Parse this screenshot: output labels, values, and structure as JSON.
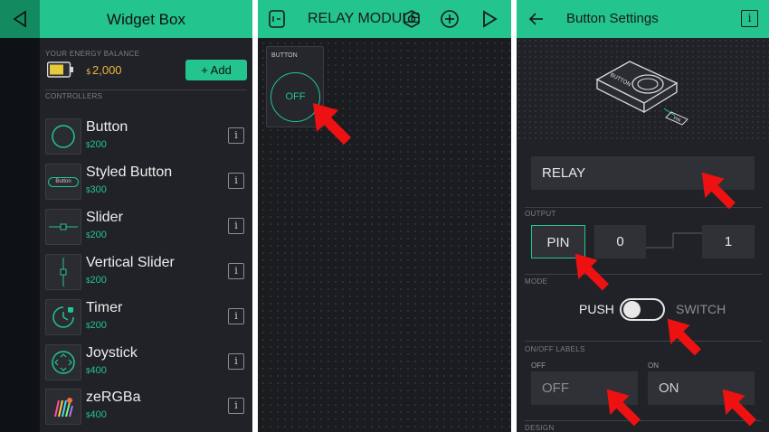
{
  "widget_box": {
    "title": "Widget Box",
    "energy_label": "YOUR ENERGY BALANCE",
    "energy_value": "2,000",
    "add_label": "+ Add",
    "controllers_label": "CONTROLLERS",
    "info_glyph": "i",
    "items": [
      {
        "name": "Button",
        "price": "200",
        "icon": "circle-icon"
      },
      {
        "name": "Styled Button",
        "price": "300",
        "icon": "styled-button-icon",
        "icon_text": "Button"
      },
      {
        "name": "Slider",
        "price": "200",
        "icon": "slider-icon"
      },
      {
        "name": "Vertical Slider",
        "price": "200",
        "icon": "vertical-slider-icon"
      },
      {
        "name": "Timer",
        "price": "200",
        "icon": "timer-icon"
      },
      {
        "name": "Joystick",
        "price": "400",
        "icon": "joystick-icon"
      },
      {
        "name": "zeRGBa",
        "price": "400",
        "icon": "zebra-icon"
      }
    ]
  },
  "project": {
    "title": "RELAY MODULE",
    "widget_label": "BUTTON",
    "widget_state": "OFF"
  },
  "button_settings": {
    "title": "Button Settings",
    "info_glyph": "i",
    "device_label": "BUTTON",
    "pin_tag": "PIN",
    "name_value": "RELAY",
    "output_label": "OUTPUT",
    "pin_button": "PIN",
    "range_low": "0",
    "range_high": "1",
    "mode_label": "MODE",
    "mode_push": "PUSH",
    "mode_switch": "SWITCH",
    "mode_is_switch": false,
    "labels_label": "ON/OFF LABELS",
    "off_label": "OFF",
    "on_label": "ON",
    "off_value": "OFF",
    "on_value": "ON",
    "design_label": "DESIGN"
  },
  "colors": {
    "accent": "#23c48e",
    "panel": "#212227",
    "energy": "#eab63b",
    "annotation": "#ee1111"
  }
}
